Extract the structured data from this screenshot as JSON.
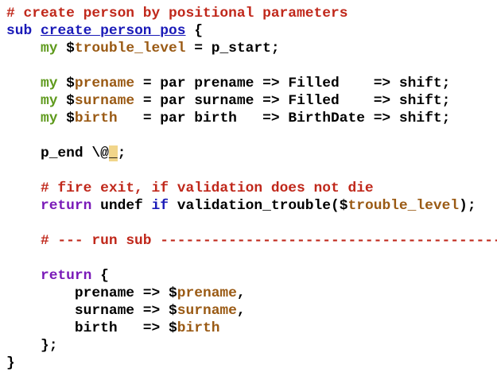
{
  "colors": {
    "comment": "#c0281b",
    "keyword": "#1a1ab8",
    "my": "#5f9a1d",
    "return": "#7a1ab8",
    "variable": "#9a5a14",
    "highlight": "#f1d58a"
  },
  "code": {
    "l1": {
      "comment": "# create person by positional parameters"
    },
    "l2": {
      "kw": "sub",
      "sp": " ",
      "name": "create_person_pos",
      "rest": " {"
    },
    "l3": {
      "ind": "    ",
      "my": "my",
      "sigil": " $",
      "var": "trouble_level",
      "rest": " = p_start;"
    },
    "l5": {
      "ind": "    ",
      "my": "my",
      "sigil": " $",
      "var": "prename",
      "rest": " = par prename => Filled    => shift;"
    },
    "l6": {
      "ind": "    ",
      "my": "my",
      "sigil": " $",
      "var": "surname",
      "rest": " = par surname => Filled    => shift;"
    },
    "l7": {
      "ind": "    ",
      "my": "my",
      "sigil": " $",
      "var": "birth",
      "rest": "   = par birth   => BirthDate => shift;"
    },
    "l9": {
      "ind": "    ",
      "text": "p_end \\@",
      "hl": "_",
      "rest": ";"
    },
    "l11": {
      "ind": "    ",
      "comment": "# fire exit, if validation does not die"
    },
    "l12": {
      "ind": "    ",
      "ret": "return",
      "sp1": " undef ",
      "kw": "if",
      "mid": " validation_trouble(",
      "sigil": "$",
      "var": "trouble_level",
      "rest": ");"
    },
    "l14": {
      "ind": "    ",
      "comment": "# --- run sub ----------------------------------------------------"
    },
    "l16": {
      "ind": "    ",
      "ret": "return",
      "rest": " {"
    },
    "l17": {
      "ind": "        ",
      "text": "prename => ",
      "sigil": "$",
      "var": "prename",
      "rest": ","
    },
    "l18": {
      "ind": "        ",
      "text": "surname => ",
      "sigil": "$",
      "var": "surname",
      "rest": ","
    },
    "l19": {
      "ind": "        ",
      "text": "birth   => ",
      "sigil": "$",
      "var": "birth"
    },
    "l20": {
      "ind": "    ",
      "text": "};"
    },
    "l21": {
      "text": "}"
    }
  }
}
